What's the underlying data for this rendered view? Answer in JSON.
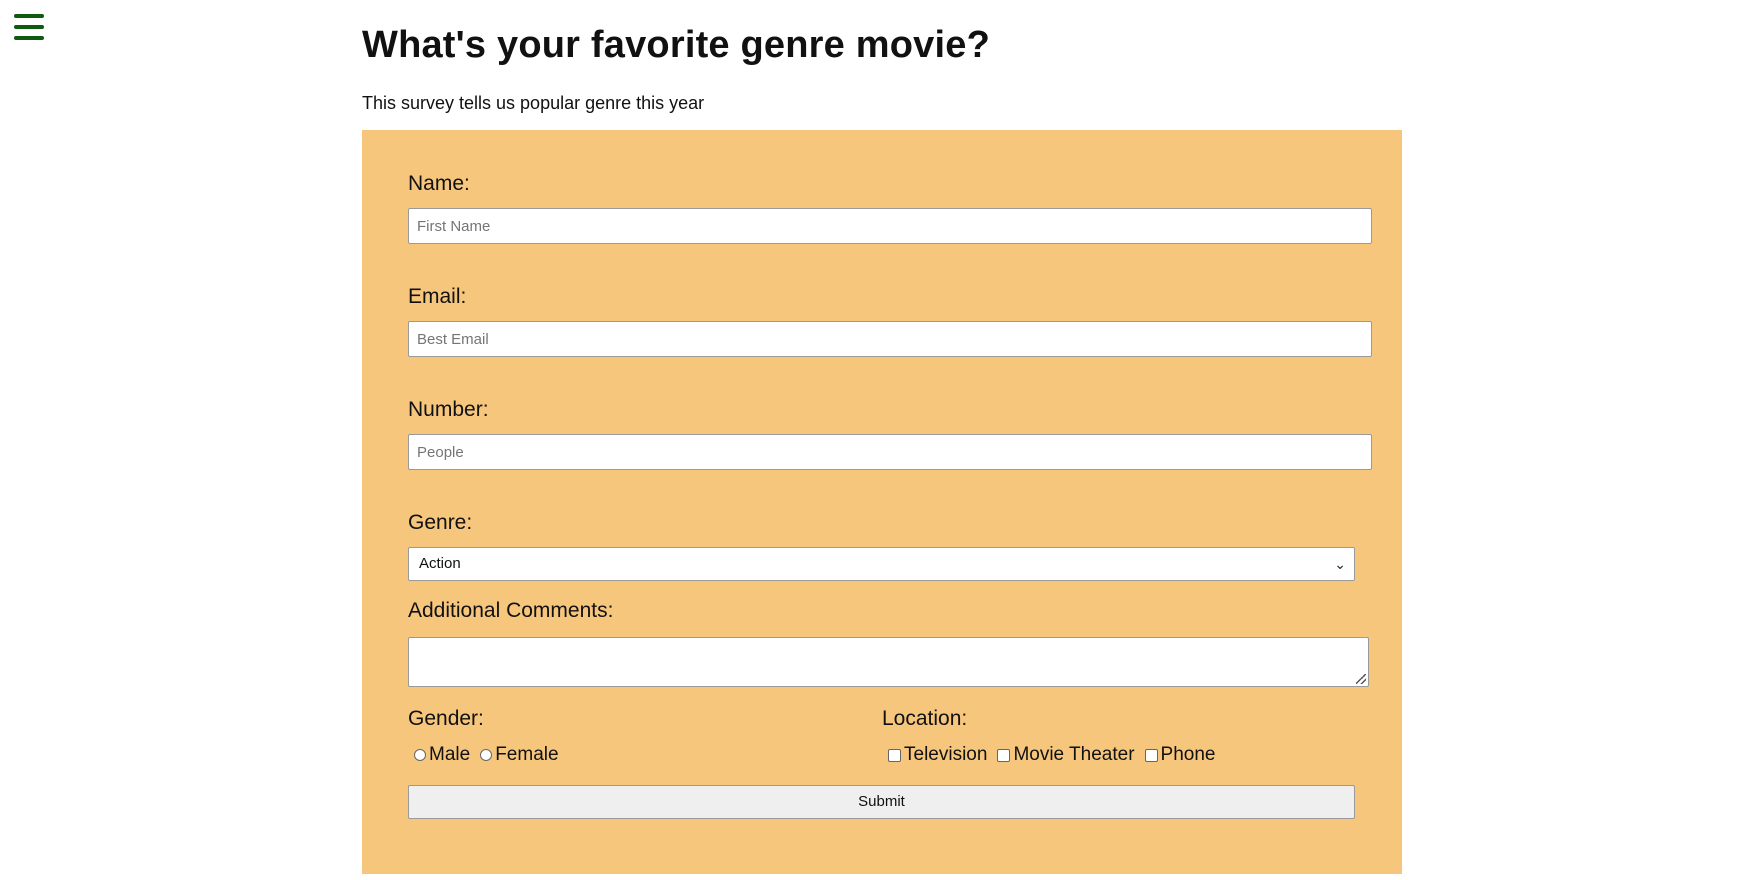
{
  "page": {
    "title": "What's your favorite genre movie?",
    "subtitle": "This survey tells us popular genre this year"
  },
  "nav": {
    "menu_icon": "hamburger-menu-icon",
    "menu_color": "#0f5a0f"
  },
  "form": {
    "background": "#f7c67d",
    "name": {
      "label": "Name:",
      "placeholder": "First Name",
      "value": ""
    },
    "email": {
      "label": "Email:",
      "placeholder": "Best Email",
      "value": ""
    },
    "number": {
      "label": "Number:",
      "placeholder": "People",
      "value": ""
    },
    "genre": {
      "label": "Genre:",
      "selected": "Action"
    },
    "comments": {
      "label": "Additional Comments:",
      "value": ""
    },
    "gender": {
      "label": "Gender:",
      "options": [
        {
          "label": "Male",
          "checked": false
        },
        {
          "label": "Female",
          "checked": false
        }
      ]
    },
    "location": {
      "label": "Location:",
      "options": [
        {
          "label": "Television",
          "checked": false
        },
        {
          "label": "Movie Theater",
          "checked": false
        },
        {
          "label": "Phone",
          "checked": false
        }
      ]
    },
    "submit_label": "Submit"
  }
}
